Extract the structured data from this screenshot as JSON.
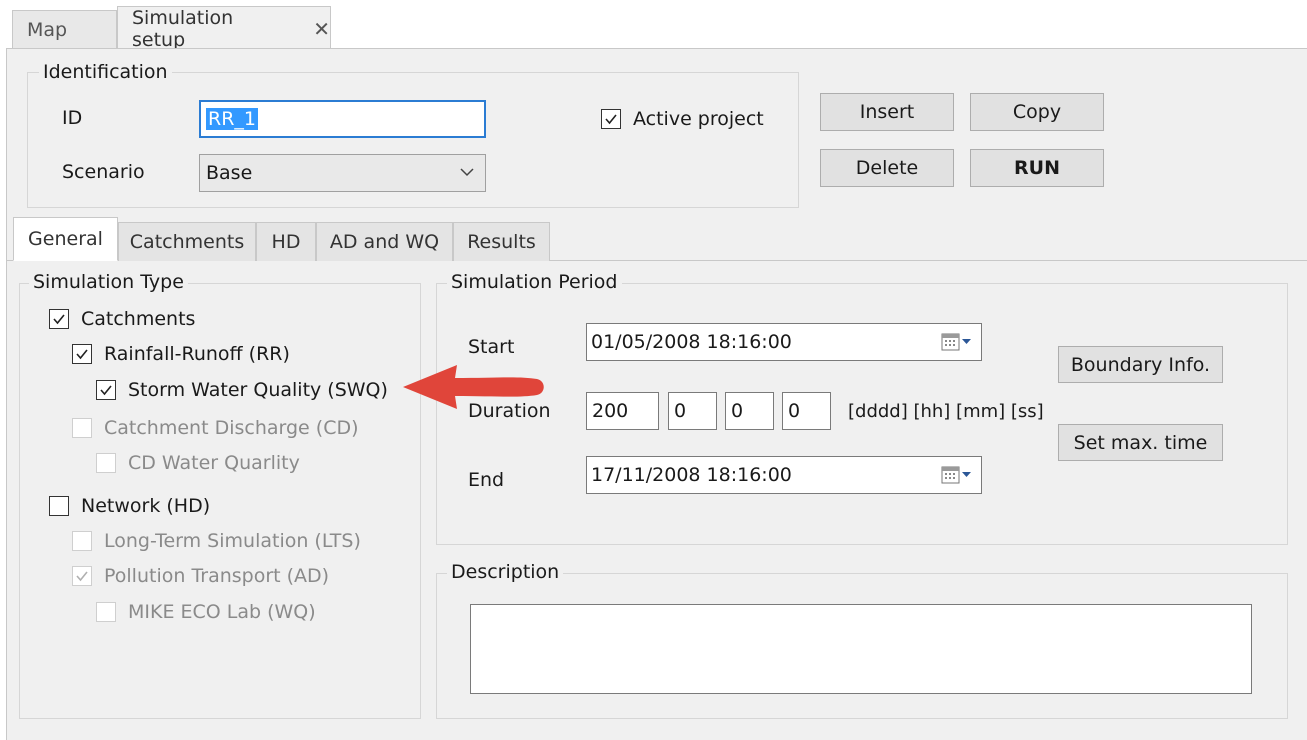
{
  "doc_tabs": [
    {
      "label": "Map",
      "active": false
    },
    {
      "label": "Simulation setup",
      "active": true
    }
  ],
  "identification": {
    "title": "Identification",
    "id_label": "ID",
    "id_value": "RR_1",
    "scenario_label": "Scenario",
    "scenario_value": "Base",
    "active_project_label": "Active project",
    "active_project_checked": true
  },
  "buttons": {
    "insert": "Insert",
    "copy": "Copy",
    "delete": "Delete",
    "run": "RUN",
    "boundary_info": "Boundary Info.",
    "set_max_time": "Set max. time"
  },
  "inner_tabs": [
    "General",
    "Catchments",
    "HD",
    "AD and WQ",
    "Results"
  ],
  "simulation_type": {
    "title": "Simulation Type",
    "items": [
      {
        "label": "Catchments",
        "checked": true,
        "enabled": true
      },
      {
        "label": "Rainfall-Runoff (RR)",
        "checked": true,
        "enabled": true
      },
      {
        "label": "Storm Water Quality (SWQ)",
        "checked": true,
        "enabled": true
      },
      {
        "label": "Catchment Discharge (CD)",
        "checked": false,
        "enabled": false
      },
      {
        "label": "CD Water Quarlity",
        "checked": false,
        "enabled": false
      },
      {
        "label": "Network (HD)",
        "checked": false,
        "enabled": true
      },
      {
        "label": "Long-Term Simulation (LTS)",
        "checked": false,
        "enabled": false
      },
      {
        "label": "Pollution Transport (AD)",
        "checked": true,
        "enabled": false
      },
      {
        "label": "MIKE ECO Lab (WQ)",
        "checked": false,
        "enabled": false
      }
    ]
  },
  "simulation_period": {
    "title": "Simulation Period",
    "start_label": "Start",
    "start_value": "01/05/2008 18:16:00",
    "duration_label": "Duration",
    "duration_days": "200",
    "duration_hours": "0",
    "duration_minutes": "0",
    "duration_seconds": "0",
    "duration_units": "[dddd] [hh] [mm] [ss]",
    "end_label": "End",
    "end_value": "17/11/2008 18:16:00"
  },
  "description": {
    "title": "Description",
    "value": ""
  },
  "colors": {
    "panel_bg": "#f0f0f0",
    "focus_border": "#2b7cd3",
    "selection": "#3399ff",
    "arrow": "#e0453a"
  }
}
